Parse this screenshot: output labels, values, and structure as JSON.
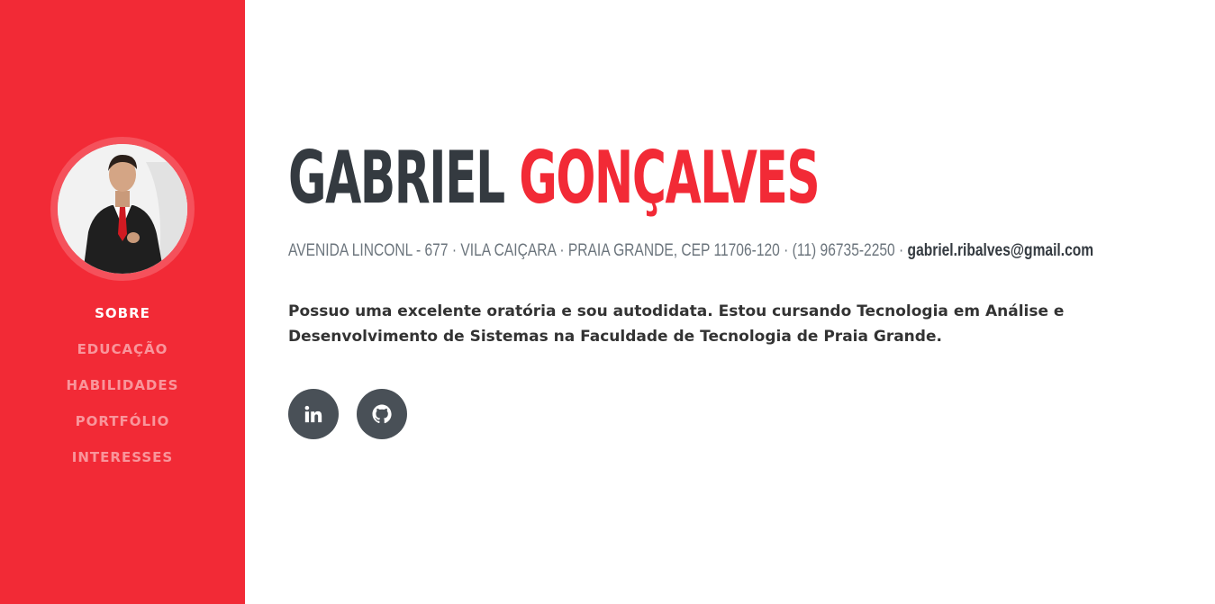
{
  "profile": {
    "first_name": "GABRIEL",
    "last_name": "GONÇALVES",
    "address": "AVENIDA LINCONL - 677 · VILA CAIÇARA · PRAIA GRANDE, CEP 11706-120 · (11) 96735-2250 ·",
    "email": "gabriel.ribalves@gmail.com",
    "about": "Possuo uma excelente oratória e sou autodidata. Estou cursando Tecnologia em Análise e Desenvolvimento de Sistemas na Faculdade de Tecnologia de Praia Grande."
  },
  "nav": {
    "items": [
      {
        "label": "SOBRE",
        "active": true
      },
      {
        "label": "EDUCAÇÃO",
        "active": false
      },
      {
        "label": "HABILIDADES",
        "active": false
      },
      {
        "label": "PORTFÓLIO",
        "active": false
      },
      {
        "label": "INTERESSES",
        "active": false
      }
    ]
  },
  "social": {
    "icons": [
      "linkedin-icon",
      "github-icon"
    ]
  },
  "colors": {
    "accent": "#f22a36",
    "dark": "#343a40",
    "muted": "#6c757d",
    "social_bg": "#495057"
  }
}
